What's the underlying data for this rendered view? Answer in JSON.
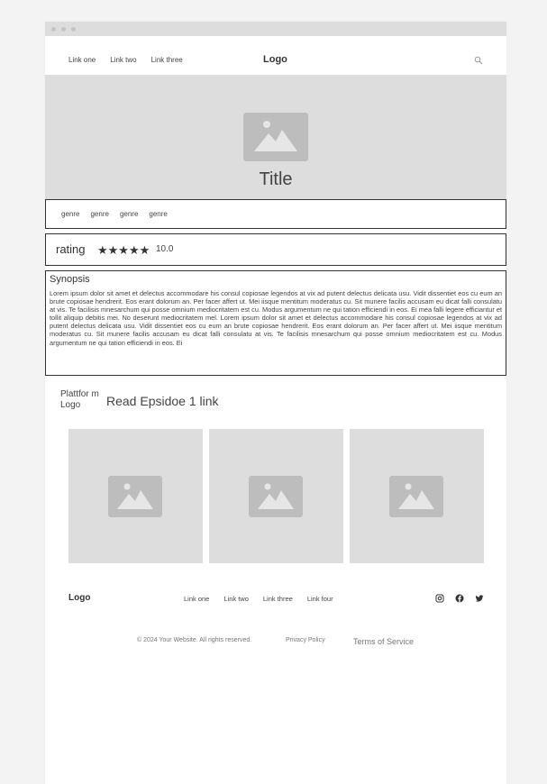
{
  "header": {
    "nav": [
      "Link one",
      "Link two",
      "Link three"
    ],
    "logo": "Logo"
  },
  "hero": {
    "title": "Title"
  },
  "genres": [
    "genre",
    "genre",
    "genre",
    "genre"
  ],
  "rating": {
    "label": "rating",
    "stars": "★★★★★",
    "value": "10.0"
  },
  "synopsis": {
    "heading": "Synopsis",
    "text": "Lorem ipsum dolor sit amet et delectus accommodare his consul copiosae legendos at vix ad putent delectus delicata usu. Vidit dissentiet eos cu eum an brute copiosae hendrerit. Eos erant dolorum an. Per facer affert ut. Mei iisque mentitum moderatus cu. Sit munere facilis accusam eu dicat falli consulatu at vis. Te facilisis mnesarchum qui posse omnium mediocritatem est cu. Modus argumentum ne qui tation efficiendi in eos. Ei mea falli legere efficiantur et tollit aliquip debitis mei. No deserunt mediocritatem mel. Lorem ipsum dolor sit amet et delectus accommodare his consul copiosae legendos at vix ad putent delectus delicata usu. Vidit dissentiet eos cu eum an brute copiosae hendrerit. Eos erant dolorum an. Per facer affert ut. Mei iisque mentitum moderatus cu. Sit munere facilis accusam eu dicat falli consulatu at vis. Te facilisis mnesarchum qui posse omnium mediocritatem est cu. Modus argumentum ne qui tation efficiendi in eos. Ei"
  },
  "platform": {
    "logo": "Plattfor m Logo",
    "link": "Read Epsidoe 1 link"
  },
  "footer": {
    "logo": "Logo",
    "nav": [
      "Link one",
      "Link two",
      "Link three",
      "Link four"
    ],
    "copyright": "© 2024 Your Website. All rights reserved.",
    "privacy": "Privacy Policy",
    "terms": "Terms of Service",
    "social_icons": [
      "instagram-icon",
      "facebook-icon",
      "twitter-icon"
    ]
  },
  "colors": {
    "placeholder": "#dddddd",
    "icon": "#bdbdbd",
    "border": "#333333"
  }
}
